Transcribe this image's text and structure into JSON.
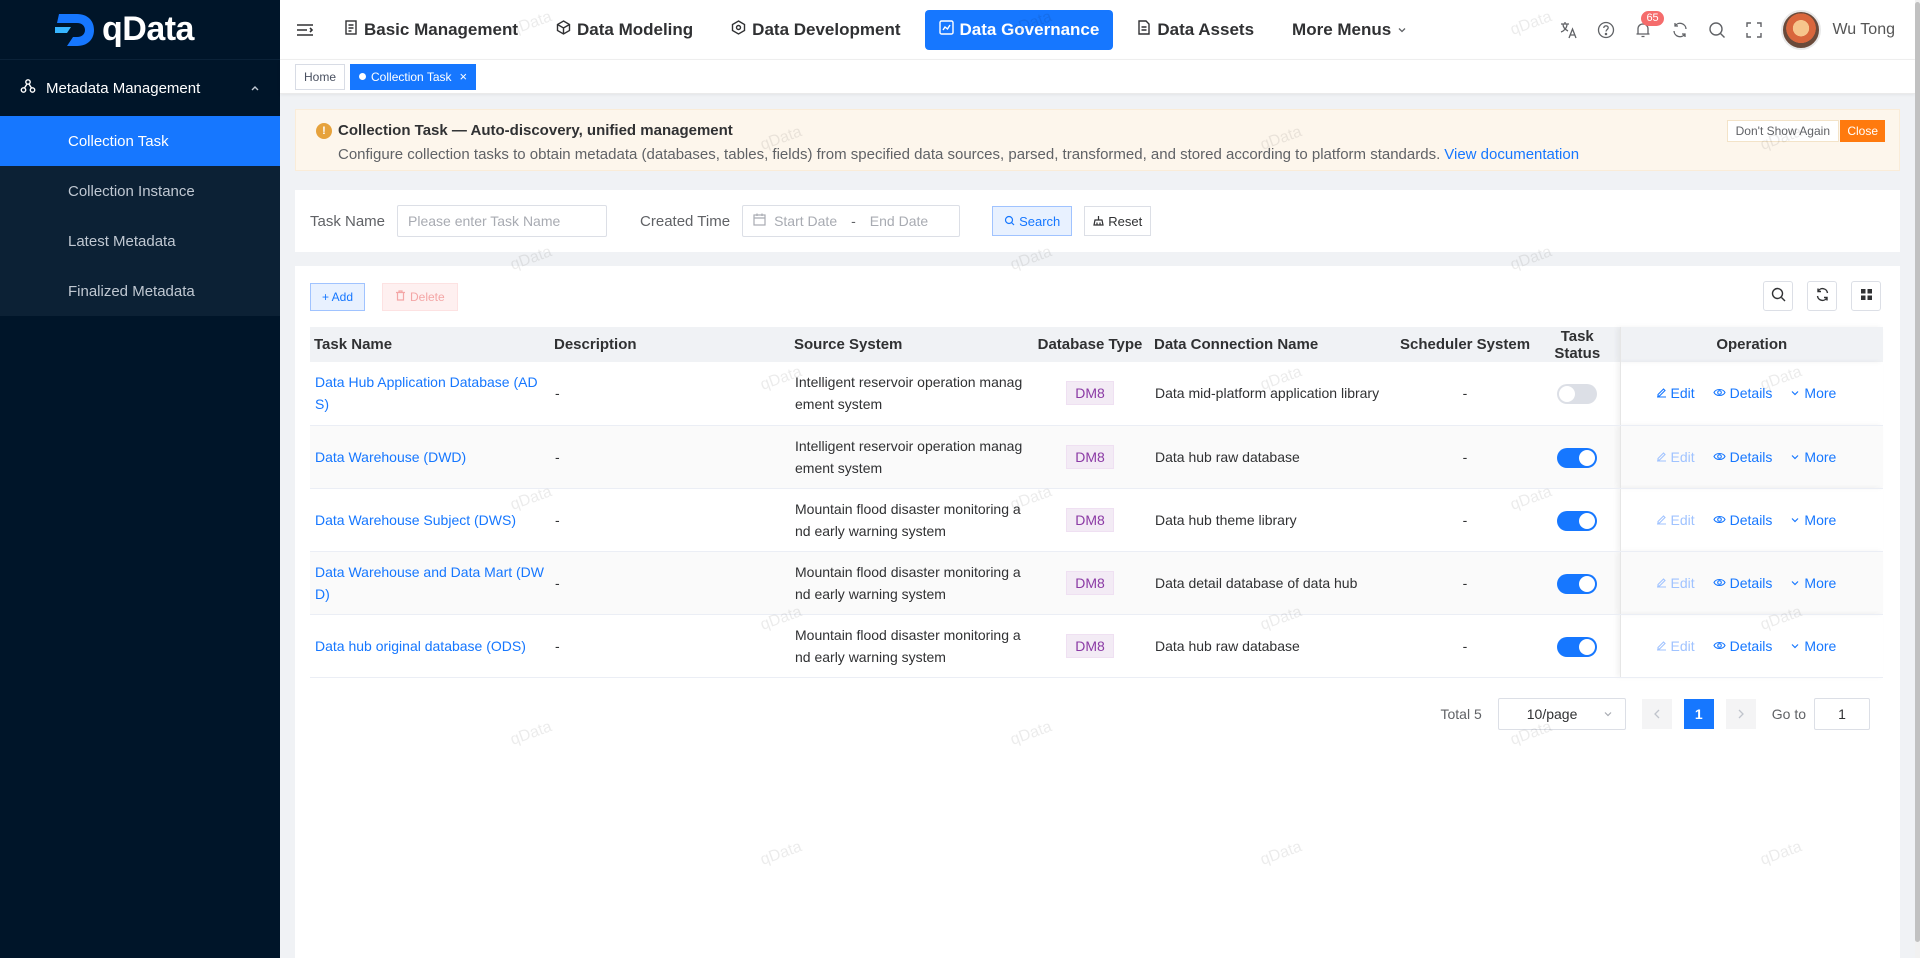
{
  "app": {
    "logo_text": "qData"
  },
  "sidebar": {
    "group_label": "Metadata Management",
    "items": [
      {
        "label": "Collection Task",
        "active": true
      },
      {
        "label": "Collection Instance",
        "active": false
      },
      {
        "label": "Latest Metadata",
        "active": false
      },
      {
        "label": "Finalized Metadata",
        "active": false
      }
    ]
  },
  "topnav": {
    "items": [
      {
        "label": "Basic Management",
        "icon": "document-icon"
      },
      {
        "label": "Data Modeling",
        "icon": "cube-icon"
      },
      {
        "label": "Data Development",
        "icon": "box-icon"
      },
      {
        "label": "Data Governance",
        "icon": "shield-chart-icon",
        "active": true
      },
      {
        "label": "Data Assets",
        "icon": "file-icon"
      }
    ],
    "more_label": "More Menus",
    "notification_count": "65",
    "username": "Wu Tong"
  },
  "tabs": [
    {
      "label": "Home"
    },
    {
      "label": "Collection Task",
      "active": true
    }
  ],
  "alert": {
    "title": "Collection Task — Auto-discovery, unified management",
    "description": "Configure collection tasks to obtain metadata (databases, tables, fields) from specified data sources, parsed, transformed, and stored according to platform standards.",
    "link": "View documentation",
    "dont_show": "Don't Show Again",
    "close": "Close"
  },
  "search": {
    "task_name_label": "Task Name",
    "task_name_placeholder": "Please enter Task Name",
    "created_time_label": "Created Time",
    "start_placeholder": "Start Date",
    "range_separator": "-",
    "end_placeholder": "End Date",
    "search_button": "Search",
    "reset_button": "Reset"
  },
  "toolbar": {
    "add": "+ Add",
    "delete": "Delete"
  },
  "table": {
    "columns": [
      "Task Name",
      "Description",
      "Source System",
      "Database Type",
      "Data Connection Name",
      "Scheduler System",
      "Task Status",
      "Operation"
    ],
    "rows": [
      {
        "name": "Data Hub Application Database (ADS)",
        "description": "-",
        "source": "Intelligent reservoir operation management system",
        "db_type": "DM8",
        "connection": "Data mid-platform application library",
        "scheduler": "-",
        "status_on": false
      },
      {
        "name": "Data Warehouse (DWD)",
        "description": "-",
        "source": "Intelligent reservoir operation management system",
        "db_type": "DM8",
        "connection": "Data hub raw database",
        "scheduler": "-",
        "status_on": true
      },
      {
        "name": "Data Warehouse Subject (DWS)",
        "description": "-",
        "source": "Mountain flood disaster monitoring and early warning system",
        "db_type": "DM8",
        "connection": "Data hub theme library",
        "scheduler": "-",
        "status_on": true
      },
      {
        "name": "Data Warehouse and Data Mart (DWD)",
        "description": "-",
        "source": "Mountain flood disaster monitoring and early warning system",
        "db_type": "DM8",
        "connection": "Data detail database of data hub",
        "scheduler": "-",
        "status_on": true
      },
      {
        "name": "Data hub original database (ODS)",
        "description": "-",
        "source": "Mountain flood disaster monitoring and early warning system",
        "db_type": "DM8",
        "connection": "Data hub raw database",
        "scheduler": "-",
        "status_on": true
      }
    ],
    "ops": {
      "edit": "Edit",
      "details": "Details",
      "more": "More"
    }
  },
  "pagination": {
    "total": "Total 5",
    "page_size": "10/page",
    "current_page": "1",
    "goto_label": "Go to",
    "goto_value": "1"
  },
  "watermark": "qData",
  "colors": {
    "primary": "#1677ff",
    "sidebar_bg": "#001529",
    "warning": "#e6a23c",
    "close_orange": "#ff7a0e",
    "tag_purple": "#8b3aa5"
  }
}
